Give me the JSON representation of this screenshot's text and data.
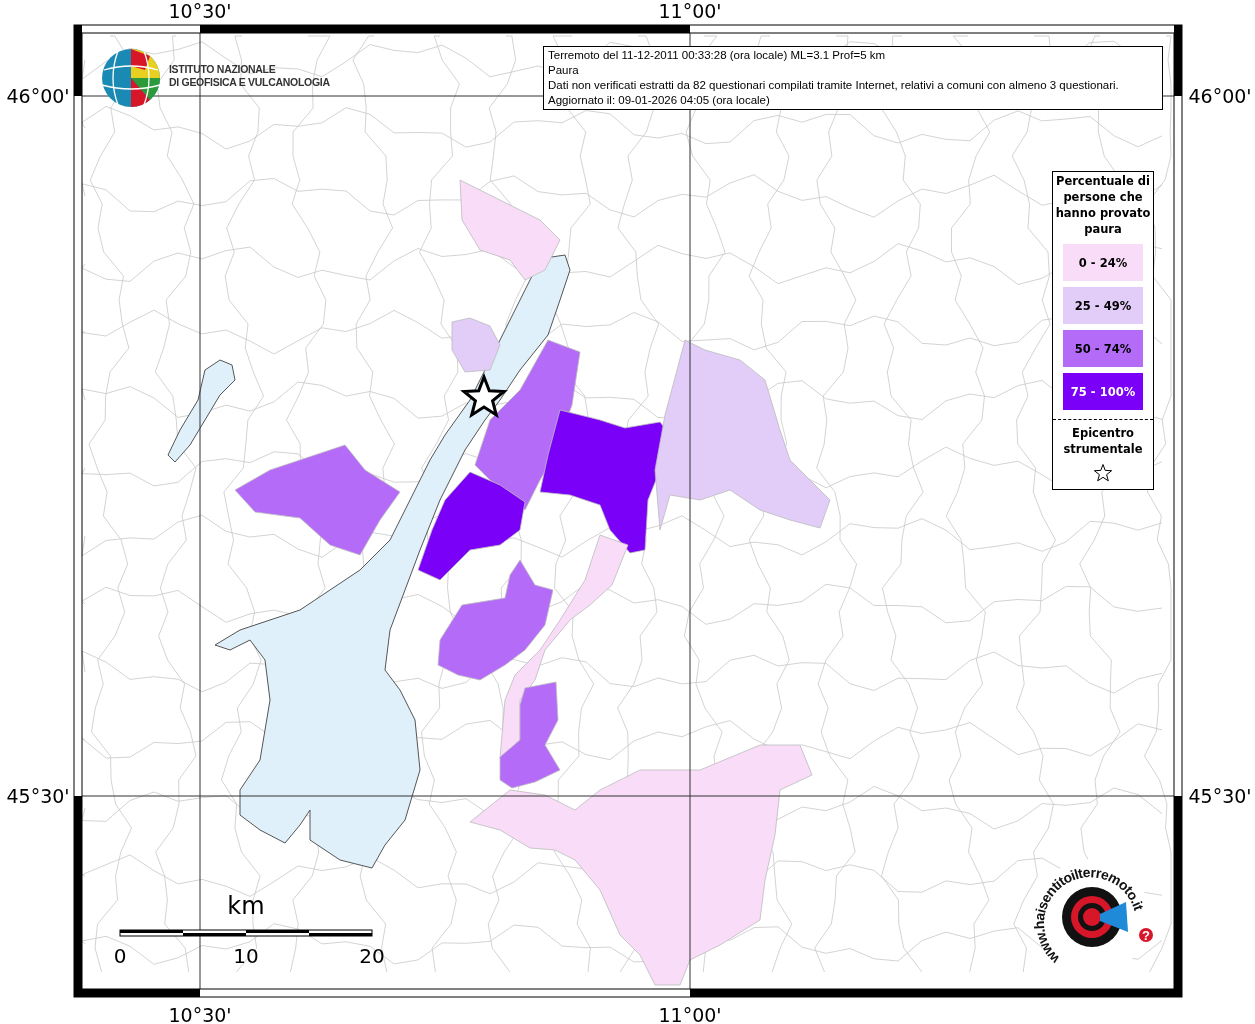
{
  "info_box": {
    "lines": [
      "Terremoto del 11-12-2011 00:33:28 (ora locale) ML=3.1 Prof=5 km",
      "Paura",
      "Dati non verificati estratti da 82 questionari compilati tramite Internet, relativi a comuni con almeno 3 questionari.",
      "Aggiornato il: 09-01-2026 04:05 (ora locale)"
    ]
  },
  "institute_logo": {
    "lines": [
      "ISTITUTO NAZIONALE",
      "DI GEOFISICA E VULCANOLOGIA"
    ]
  },
  "axes": {
    "top_labels": [
      "10°30'",
      "11°00'"
    ],
    "bottom_labels": [
      "10°30'",
      "11°00'"
    ],
    "left_labels": [
      "46°00'",
      "45°30'"
    ],
    "right_labels": [
      "46°00'",
      "45°30'"
    ]
  },
  "legend": {
    "title": "Percentuale di persone che hanno provato paura",
    "items": [
      {
        "label": "0 - 24%",
        "color": "#f8dcf8"
      },
      {
        "label": "25 - 49%",
        "color": "#e2ccf8"
      },
      {
        "label": "50 - 74%",
        "color": "#b46cf8"
      },
      {
        "label": "75 - 100%",
        "color": "#7a00f8"
      }
    ],
    "epicenter_label": "Epicentro strumentale"
  },
  "areas": [
    {
      "color": "#f8dcf8"
    },
    {
      "color": "#e2ccf8"
    },
    {
      "color": "#b46cf8"
    },
    {
      "color": "#7a00f8"
    },
    {
      "color": "#e2ccf8"
    },
    {
      "color": "#7a00f8"
    },
    {
      "color": "#b46cf8"
    },
    {
      "color": "#b46cf8"
    },
    {
      "color": "#f8dcf8"
    },
    {
      "color": "#b46cf8"
    },
    {
      "color": "#f8dcf8"
    }
  ],
  "scale_bar": {
    "unit": "km",
    "ticks": [
      "0",
      "10",
      "20"
    ]
  },
  "bottom_logo": {
    "arc_text": "www.haisentitoilterremoto.it",
    "badge": "?"
  }
}
